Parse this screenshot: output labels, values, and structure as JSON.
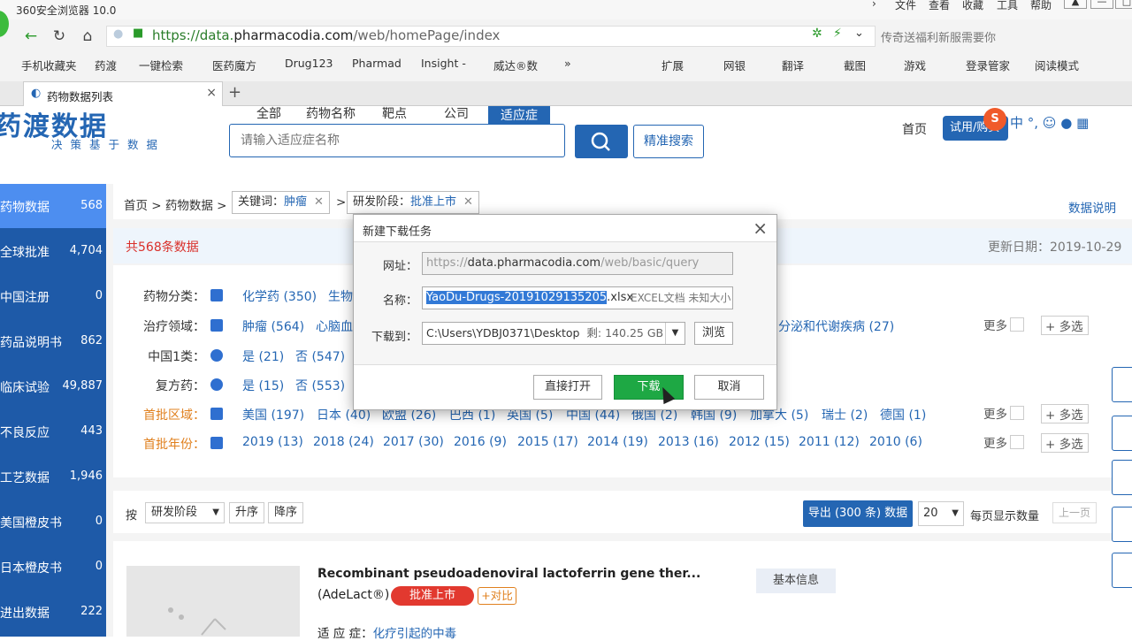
{
  "browser": {
    "app_title": "360安全浏览器 10.0",
    "menu": [
      "文件",
      "查看",
      "收藏",
      "工具",
      "帮助"
    ],
    "url_prefix": "https://data.",
    "url_domain": "pharmacodia.com",
    "url_path": "/web/homePage/index",
    "search_hint": "传奇送福利新服需要你",
    "bookmarks": [
      "手机收藏夹",
      "药渡",
      "一键检索",
      "医药魔方",
      "Drug123",
      "Pharmad",
      "Insight -",
      "威达®数",
      "扩展",
      "网银",
      "翻译",
      "截图",
      "游戏",
      "登录管家",
      "阅读模式"
    ],
    "tab_title": "药物数据列表"
  },
  "site": {
    "brand": "药渡数据",
    "tagline": "决策基于数据",
    "search_tabs": [
      "全部",
      "药物名称",
      "靶点",
      "公司"
    ],
    "search_tab_active": "适应症",
    "search_placeholder": "请输入适应症名称",
    "advanced_search": "精准搜索",
    "home_link": "首页",
    "trial_button": "试用/购买"
  },
  "sidebar": {
    "items": [
      {
        "label": "药物数据",
        "count": "568"
      },
      {
        "label": "全球批准",
        "count": "4,704"
      },
      {
        "label": "中国注册",
        "count": "0"
      },
      {
        "label": "药品说明书",
        "count": "862"
      },
      {
        "label": "临床试验",
        "count": "49,887"
      },
      {
        "label": "不良反应",
        "count": "443"
      },
      {
        "label": "工艺数据",
        "count": "1,946"
      },
      {
        "label": "美国橙皮书",
        "count": "0"
      },
      {
        "label": "日本橙皮书",
        "count": "0"
      },
      {
        "label": "进出数据",
        "count": "222"
      }
    ]
  },
  "breadcrumb": {
    "text": "首页 > 药物数据 >",
    "chip1_label": "关键词：",
    "chip1_value": "肿瘤",
    "sep": ">",
    "chip2_label": "研发阶段：",
    "chip2_value": "批准上市",
    "help": "数据说明"
  },
  "summary": {
    "total": "共568条数据",
    "update": "更新日期：2019-10-29"
  },
  "filters": {
    "drug_class": {
      "label": "药物分类：",
      "options": [
        "化学药 (350)",
        "生物"
      ]
    },
    "therapy": {
      "label": "治疗领域：",
      "options": [
        "肿瘤 (564)",
        "心脑血",
        "分泌和代谢疾病 (27)"
      ]
    },
    "china_class1": {
      "label": "中国1类：",
      "options": [
        "是 (21)",
        "否 (547)"
      ]
    },
    "compound": {
      "label": "复方药：",
      "options": [
        "是 (15)",
        "否 (553)"
      ]
    },
    "region": {
      "label": "首批区域：",
      "options": [
        "美国 (197)",
        "日本 (40)",
        "欧盟 (26)",
        "巴西 (1)",
        "英国 (5)",
        "中国 (44)",
        "俄国 (2)",
        "韩国 (9)",
        "加拿大 (5)",
        "瑞士 (2)",
        "德国 (1)"
      ]
    },
    "year": {
      "label": "首批年份：",
      "options": [
        "2019 (13)",
        "2018 (24)",
        "2017 (30)",
        "2016 (9)",
        "2015 (17)",
        "2014 (19)",
        "2013 (16)",
        "2012 (15)",
        "2011 (12)",
        "2010 (6)"
      ]
    },
    "more": "更多",
    "multi": "+ 多选"
  },
  "sort": {
    "by": "按",
    "field": "研发阶段",
    "asc": "升序",
    "desc": "降序",
    "export": "导出 (300 条) 数据",
    "page_size": "20",
    "page_size_label": "每页显示数量",
    "prev": "上一页"
  },
  "result": {
    "title": "Recombinant pseudoadenoviral lactoferrin gene ther...",
    "subtitle": "(AdeLact®)",
    "badge": "批准上市",
    "compare": "+对比",
    "basic_info": "基本信息",
    "indication_label": "适 应 症：",
    "indication_value": "化疗引起的中毒"
  },
  "dialog": {
    "title": "新建下载任务",
    "url_label": "网址：",
    "url_prefix": "https://",
    "url_domain": "data.pharmacodia.com",
    "url_path": "/web/basic/query",
    "name_label": "名称：",
    "name_selected": "YaoDu-Drugs-20191029135205",
    "name_ext": ".xlsx",
    "name_meta": "EXCEL文档 未知大小",
    "path_label": "下载到：",
    "path_value": "C:\\Users\\YDBJ0371\\Desktop",
    "path_free": "剩: 140.25 GB",
    "browse": "浏览",
    "open_direct": "直接打开",
    "download": "下载",
    "cancel": "取消"
  }
}
